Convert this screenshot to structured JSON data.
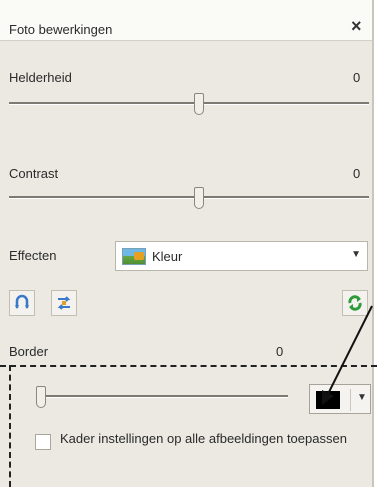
{
  "window": {
    "title": "Foto bewerkingen",
    "close_glyph": "×"
  },
  "brightness": {
    "label": "Helderheid",
    "value": "0",
    "level": 0
  },
  "contrast": {
    "label": "Contrast",
    "value": "0",
    "level": 0
  },
  "effects": {
    "label": "Effecten",
    "selected": "Kleur"
  },
  "border": {
    "label": "Border",
    "value": "0",
    "level": 0,
    "color": "#000000"
  },
  "apply_all": {
    "label": "Kader instellingen op alle afbeeldingen toepassen",
    "checked": false
  },
  "icons": {
    "left1": "flip-vertical-icon",
    "left2": "flip-horizontal-icon",
    "right": "rotate-icon",
    "slider_thumb": "slider-thumb",
    "dropdown": "chevron-down-icon"
  },
  "colors": {
    "accent": "#3a78c8",
    "panel_bg": "#ebe9e2"
  }
}
